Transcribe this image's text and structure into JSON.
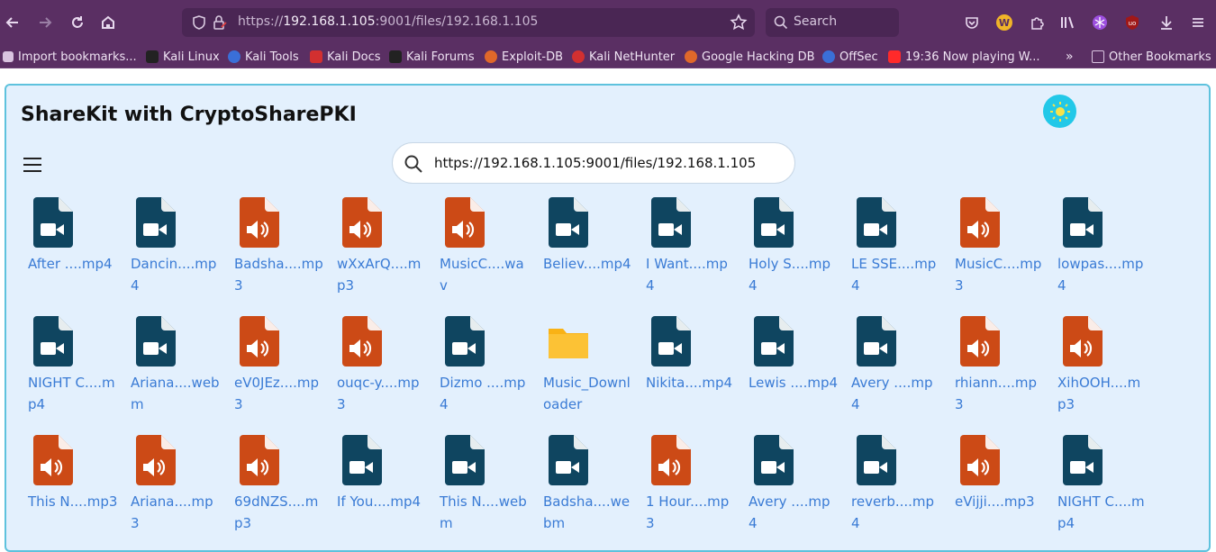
{
  "browser": {
    "url_prefix": "https://",
    "url_host": "192.168.1.105",
    "url_rest": ":9001/files/192.168.1.105",
    "search_placeholder": "Search"
  },
  "bookmarks": [
    {
      "label": "Import bookmarks...",
      "icon": "import-icon",
      "color": "#d9c4e0"
    },
    {
      "label": "Kali Linux",
      "icon": "kali-dragon-icon",
      "color": "#222222"
    },
    {
      "label": "Kali Tools",
      "icon": "kali-tools-icon",
      "color": "#3a6fd8"
    },
    {
      "label": "Kali Docs",
      "icon": "kali-docs-icon",
      "color": "#d23030"
    },
    {
      "label": "Kali Forums",
      "icon": "kali-dragon-icon",
      "color": "#222222"
    },
    {
      "label": "Exploit-DB",
      "icon": "exploit-db-icon",
      "color": "#e0682a"
    },
    {
      "label": "Kali NetHunter",
      "icon": "nethunter-icon",
      "color": "#d23030"
    },
    {
      "label": "Google Hacking DB",
      "icon": "ghdb-icon",
      "color": "#e0682a"
    },
    {
      "label": "OffSec",
      "icon": "offsec-icon",
      "color": "#3a6fd8"
    },
    {
      "label": "19:36 Now playing W...",
      "icon": "youtube-icon",
      "color": "#ff2a2a"
    },
    {
      "label": "Other Bookmarks",
      "icon": "folder-icon",
      "color": "#d9c4e0"
    }
  ],
  "app": {
    "title": "ShareKit with CryptoSharePKI",
    "search_value": "https://192.168.1.105:9001/files/192.168.1.105"
  },
  "colors": {
    "video": "#0f4560",
    "audio": "#cc4a16",
    "folder": "#f9b215"
  },
  "files": [
    {
      "name": "After ....mp4",
      "type": "video"
    },
    {
      "name": "Dancin....mp4",
      "type": "video"
    },
    {
      "name": "Badsha....mp3",
      "type": "audio"
    },
    {
      "name": "wXxArQ....mp3",
      "type": "audio"
    },
    {
      "name": "MusicC....wav",
      "type": "audio"
    },
    {
      "name": "Believ....mp4",
      "type": "video"
    },
    {
      "name": "I Want....mp4",
      "type": "video"
    },
    {
      "name": "Holy S....mp4",
      "type": "video"
    },
    {
      "name": "LE SSE....mp4",
      "type": "video"
    },
    {
      "name": "MusicC....mp3",
      "type": "audio"
    },
    {
      "name": "lowpas....mp4",
      "type": "video"
    },
    {
      "name": "NIGHT C....mp4",
      "type": "video"
    },
    {
      "name": "Ariana....webm",
      "type": "video"
    },
    {
      "name": "eV0JEz....mp3",
      "type": "audio"
    },
    {
      "name": "ouqc-y....mp3",
      "type": "audio"
    },
    {
      "name": "Dizmo ....mp4",
      "type": "video"
    },
    {
      "name": "Music_Downloader",
      "type": "folder"
    },
    {
      "name": "Nikita....mp4",
      "type": "video"
    },
    {
      "name": "Lewis ....mp4",
      "type": "video"
    },
    {
      "name": "Avery ....mp4",
      "type": "video"
    },
    {
      "name": "rhiann....mp3",
      "type": "audio"
    },
    {
      "name": "XihOOH....mp3",
      "type": "audio"
    },
    {
      "name": "This N....mp3",
      "type": "audio"
    },
    {
      "name": "Ariana....mp3",
      "type": "audio"
    },
    {
      "name": "69dNZS....mp3",
      "type": "audio"
    },
    {
      "name": "If You....mp4",
      "type": "video"
    },
    {
      "name": "This N....webm",
      "type": "video"
    },
    {
      "name": "Badsha....webm",
      "type": "video"
    },
    {
      "name": "1 Hour....mp3",
      "type": "audio"
    },
    {
      "name": "Avery ....mp4",
      "type": "video"
    },
    {
      "name": "reverb....mp4",
      "type": "video"
    },
    {
      "name": "eVijji....mp3",
      "type": "audio"
    },
    {
      "name": "NIGHT C....mp4",
      "type": "video"
    }
  ]
}
